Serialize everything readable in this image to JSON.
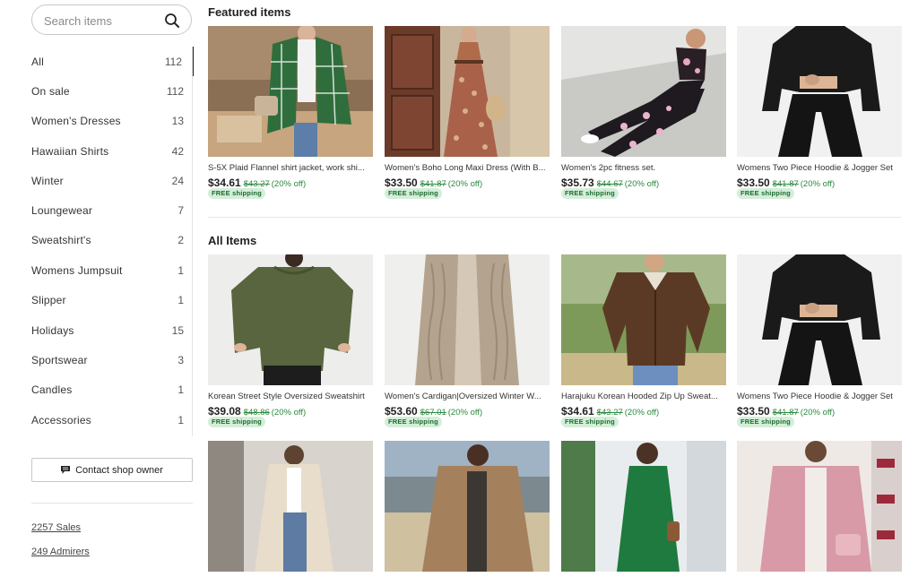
{
  "search": {
    "placeholder": "Search items"
  },
  "categories": [
    {
      "label": "All",
      "count": "112"
    },
    {
      "label": "On sale",
      "count": "112"
    },
    {
      "label": "Women's Dresses",
      "count": "13"
    },
    {
      "label": "Hawaiian Shirts",
      "count": "42"
    },
    {
      "label": "Winter",
      "count": "24"
    },
    {
      "label": "Loungewear",
      "count": "7"
    },
    {
      "label": "Sweatshirt's",
      "count": "2"
    },
    {
      "label": "Womens Jumpsuit",
      "count": "1"
    },
    {
      "label": "Slipper",
      "count": "1"
    },
    {
      "label": "Holidays",
      "count": "15"
    },
    {
      "label": "Sportswear",
      "count": "3"
    },
    {
      "label": "Candles",
      "count": "1"
    },
    {
      "label": "Accessories",
      "count": "1"
    }
  ],
  "contact_label": "Contact shop owner",
  "stats": {
    "sales": "2257 Sales",
    "admirers": "249 Admirers"
  },
  "featured": {
    "title": "Featured items",
    "items": [
      {
        "title": "S-5X Plaid Flannel shirt jacket, work shi...",
        "price": "$34.61",
        "orig": "$43.27",
        "off": "(20% off)",
        "ship": "FREE shipping",
        "icon": "plaid-jacket-image"
      },
      {
        "title": "Women's Boho Long Maxi Dress (With B...",
        "price": "$33.50",
        "orig": "$41.87",
        "off": "(20% off)",
        "ship": "FREE shipping",
        "icon": "maxi-dress-image"
      },
      {
        "title": "Women's 2pc fitness set.",
        "price": "$35.73",
        "orig": "$44.67",
        "off": "(20% off)",
        "ship": "FREE shipping",
        "icon": "fitness-set-image"
      },
      {
        "title": "Womens Two Piece Hoodie & Jogger Set",
        "price": "$33.50",
        "orig": "$41.87",
        "off": "(20% off)",
        "ship": "FREE shipping",
        "icon": "hoodie-set-image"
      }
    ]
  },
  "all": {
    "title": "All Items",
    "items": [
      {
        "title": "Korean Street Style Oversized Sweatshirt",
        "price": "$39.08",
        "orig": "$48.86",
        "off": "(20% off)",
        "ship": "FREE shipping",
        "icon": "sweatshirt-image"
      },
      {
        "title": "Women's Cardigan|Oversized Winter W...",
        "price": "$53.60",
        "orig": "$67.01",
        "off": "(20% off)",
        "ship": "FREE shipping",
        "icon": "cardigan-image"
      },
      {
        "title": "Harajuku Korean Hooded Zip Up Sweat...",
        "price": "$34.61",
        "orig": "$43.27",
        "off": "(20% off)",
        "ship": "FREE shipping",
        "icon": "zip-hoodie-image"
      },
      {
        "title": "Womens Two Piece Hoodie & Jogger Set",
        "price": "$33.50",
        "orig": "$41.87",
        "off": "(20% off)",
        "ship": "FREE shipping",
        "icon": "hoodie-set-image"
      }
    ],
    "more_images": [
      "beige-cardigan-image",
      "brown-cardigan-image",
      "green-dress-image",
      "pink-knit-image"
    ]
  },
  "colors": {
    "sale_green": "#2c8a3e",
    "ship_bg": "#d4eed9",
    "ship_text": "#1e6b30"
  }
}
